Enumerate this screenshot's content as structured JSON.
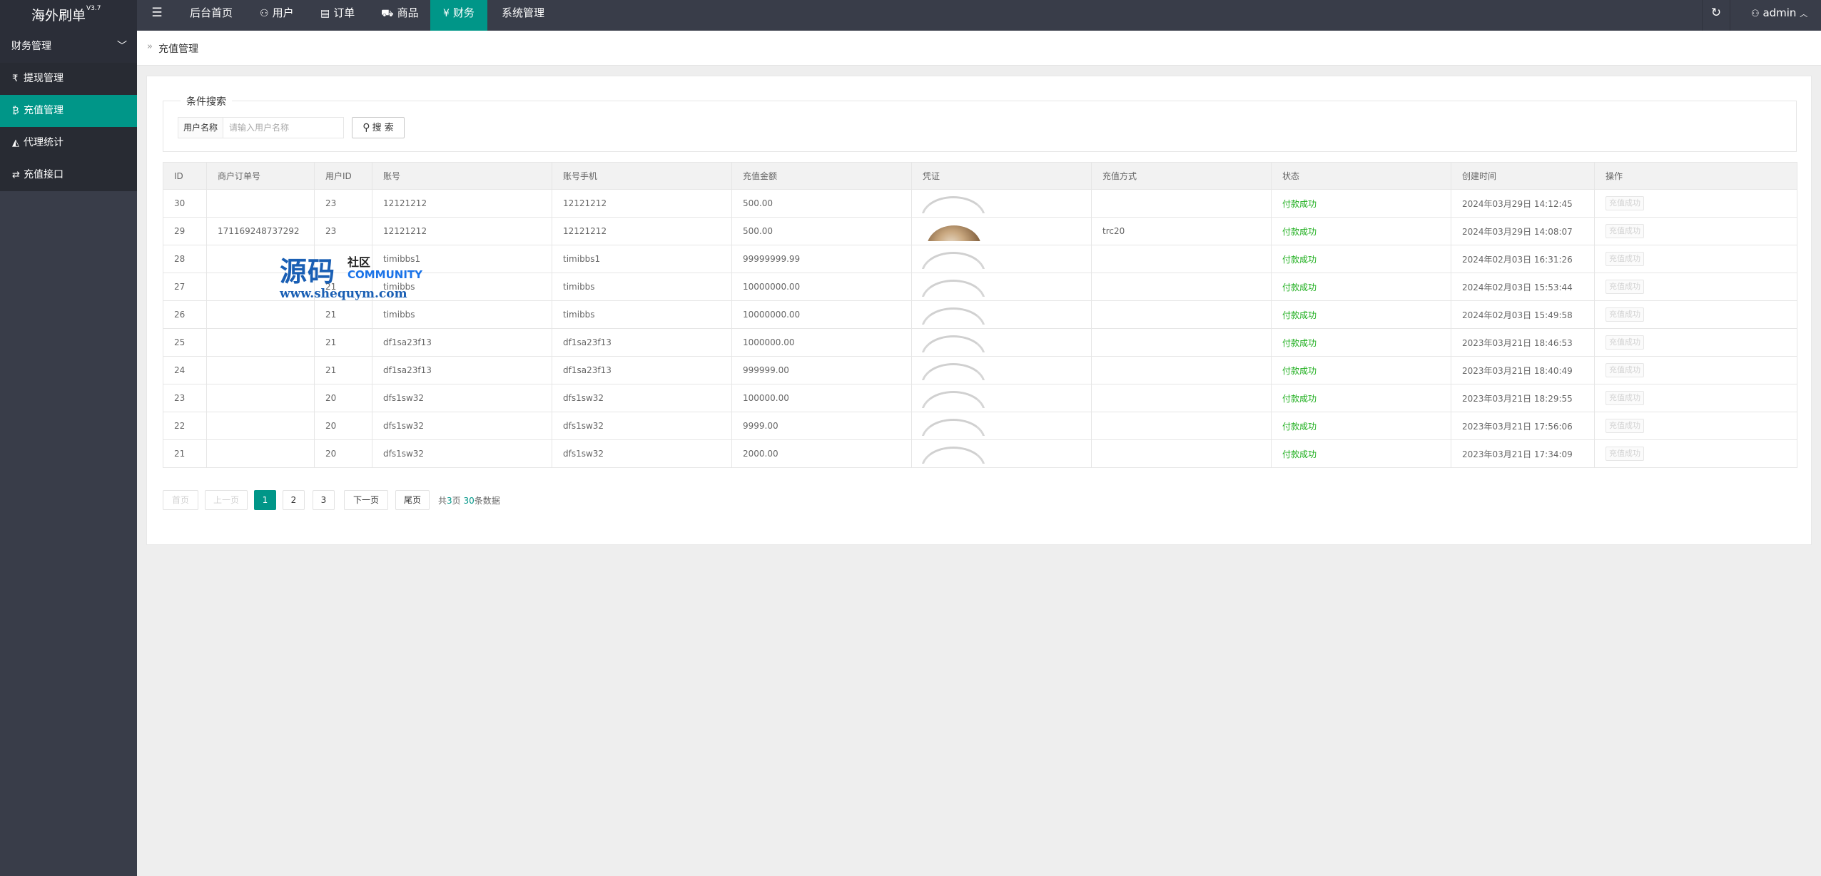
{
  "header": {
    "app_name": "海外刷单",
    "version": "V3.7",
    "nav": [
      {
        "label": "后台首页",
        "icon": ""
      },
      {
        "label": "用户",
        "icon": "user-icon"
      },
      {
        "label": "订单",
        "icon": "document-icon"
      },
      {
        "label": "商品",
        "icon": "cart-icon"
      },
      {
        "label": "财务",
        "icon": "yen-icon"
      },
      {
        "label": "系统管理",
        "icon": ""
      }
    ],
    "active_nav": "财务",
    "user": "admin"
  },
  "sidebar": {
    "group": "财务管理",
    "items": [
      {
        "label": "提现管理",
        "icon": "rupee-icon"
      },
      {
        "label": "充值管理",
        "icon": "bitcoin-icon"
      },
      {
        "label": "代理统计",
        "icon": "area-chart-icon"
      },
      {
        "label": "充值接口",
        "icon": "exchange-icon"
      }
    ],
    "active": "充值管理"
  },
  "breadcrumb": {
    "sep": "»",
    "text": "充值管理"
  },
  "filter": {
    "legend": "条件搜索",
    "label": "用户名称",
    "placeholder": "请输入用户名称",
    "button": "搜 索"
  },
  "table": {
    "columns": [
      "ID",
      "商户订单号",
      "用户ID",
      "账号",
      "账号手机",
      "充值金额",
      "凭证",
      "充值方式",
      "状态",
      "创建时间",
      "操作"
    ],
    "rows": [
      {
        "id": "30",
        "order": "",
        "uid": "23",
        "account": "12121212",
        "phone": "12121212",
        "amount": "500.00",
        "voucher": "loading",
        "method": "",
        "status": "付款成功",
        "created": "2024年03月29日 14:12:45",
        "op": "充值成功"
      },
      {
        "id": "29",
        "order": "171169248737292",
        "uid": "23",
        "account": "12121212",
        "phone": "12121212",
        "amount": "500.00",
        "voucher": "photo",
        "method": "trc20",
        "status": "付款成功",
        "created": "2024年03月29日 14:08:07",
        "op": "充值成功"
      },
      {
        "id": "28",
        "order": "",
        "uid": "",
        "account": "timibbs1",
        "phone": "timibbs1",
        "amount": "99999999.99",
        "voucher": "loading",
        "method": "",
        "status": "付款成功",
        "created": "2024年02月03日 16:31:26",
        "op": "充值成功"
      },
      {
        "id": "27",
        "order": "",
        "uid": "21",
        "account": "timibbs",
        "phone": "timibbs",
        "amount": "10000000.00",
        "voucher": "loading",
        "method": "",
        "status": "付款成功",
        "created": "2024年02月03日 15:53:44",
        "op": "充值成功"
      },
      {
        "id": "26",
        "order": "",
        "uid": "21",
        "account": "timibbs",
        "phone": "timibbs",
        "amount": "10000000.00",
        "voucher": "loading",
        "method": "",
        "status": "付款成功",
        "created": "2024年02月03日 15:49:58",
        "op": "充值成功"
      },
      {
        "id": "25",
        "order": "",
        "uid": "21",
        "account": "df1sa23f13",
        "phone": "df1sa23f13",
        "amount": "1000000.00",
        "voucher": "loading",
        "method": "",
        "status": "付款成功",
        "created": "2023年03月21日 18:46:53",
        "op": "充值成功"
      },
      {
        "id": "24",
        "order": "",
        "uid": "21",
        "account": "df1sa23f13",
        "phone": "df1sa23f13",
        "amount": "999999.00",
        "voucher": "loading",
        "method": "",
        "status": "付款成功",
        "created": "2023年03月21日 18:40:49",
        "op": "充值成功"
      },
      {
        "id": "23",
        "order": "",
        "uid": "20",
        "account": "dfs1sw32",
        "phone": "dfs1sw32",
        "amount": "100000.00",
        "voucher": "loading",
        "method": "",
        "status": "付款成功",
        "created": "2023年03月21日 18:29:55",
        "op": "充值成功"
      },
      {
        "id": "22",
        "order": "",
        "uid": "20",
        "account": "dfs1sw32",
        "phone": "dfs1sw32",
        "amount": "9999.00",
        "voucher": "loading",
        "method": "",
        "status": "付款成功",
        "created": "2023年03月21日 17:56:06",
        "op": "充值成功"
      },
      {
        "id": "21",
        "order": "",
        "uid": "20",
        "account": "dfs1sw32",
        "phone": "dfs1sw32",
        "amount": "2000.00",
        "voucher": "loading",
        "method": "",
        "status": "付款成功",
        "created": "2023年03月21日 17:34:09",
        "op": "充值成功"
      }
    ]
  },
  "pagination": {
    "first": "首页",
    "prev": "上一页",
    "pages": [
      "1",
      "2",
      "3"
    ],
    "current": "1",
    "next": "下一页",
    "last": "尾页",
    "info_prefix": "共",
    "total_pages": "3",
    "info_mid": "页 ",
    "total_records": "30",
    "info_suffix": "条数据"
  },
  "watermark": {
    "big": "源码",
    "small": "社区",
    "community": "COMMUNITY",
    "url": "www.shequym.com"
  },
  "colors": {
    "header_bg": "#393D49",
    "accent": "#009688",
    "status_ok": "#1aad19"
  }
}
